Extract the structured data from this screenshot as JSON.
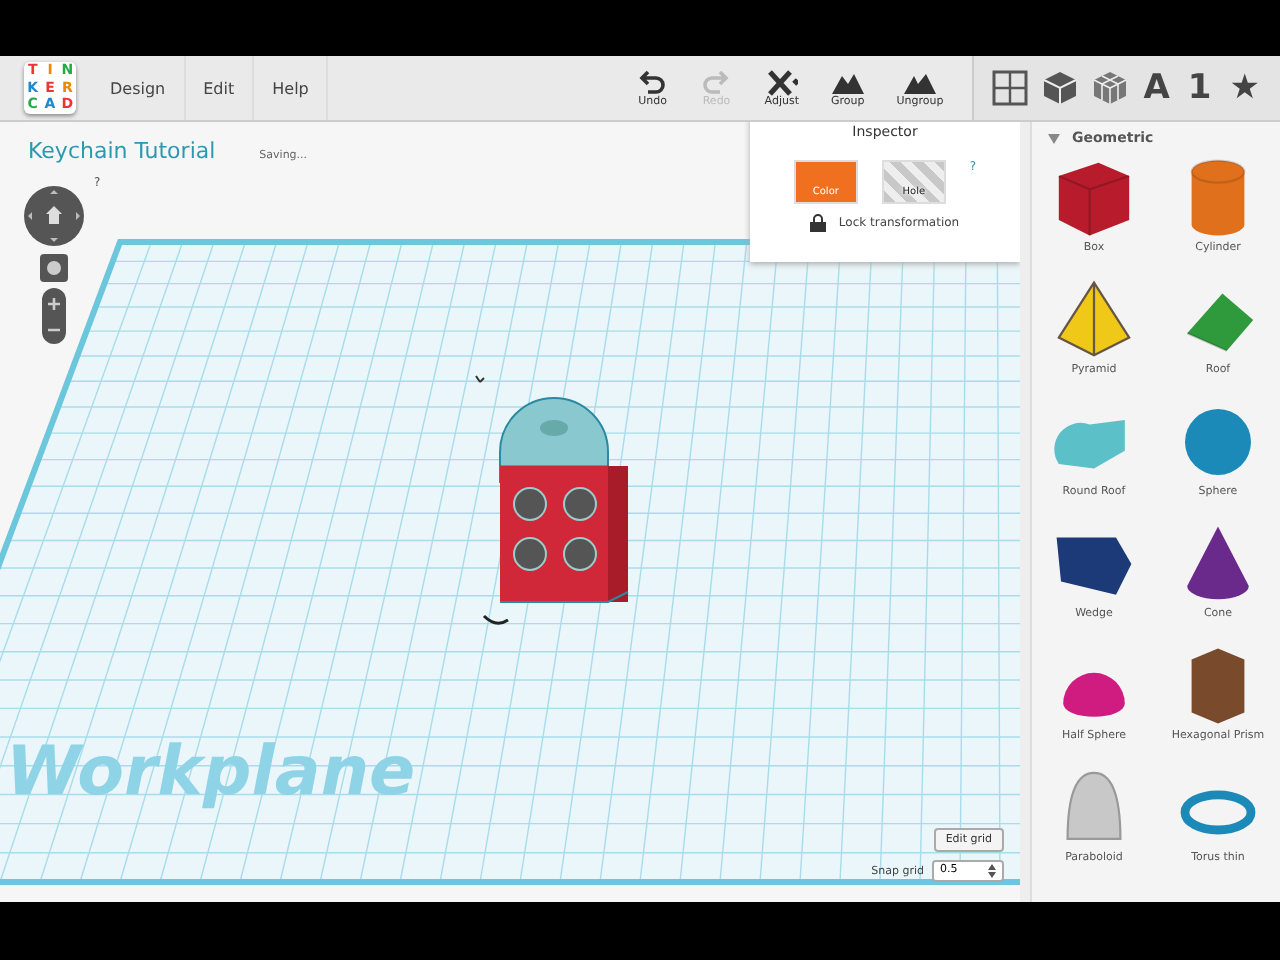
{
  "menu": [
    {
      "label": "Design"
    },
    {
      "label": "Edit"
    },
    {
      "label": "Help"
    }
  ],
  "logo": [
    "T",
    "I",
    "N",
    "K",
    "E",
    "R",
    "C",
    "A",
    "D"
  ],
  "toolbar": [
    {
      "kind": "undo",
      "label": "Undo",
      "disabled": false
    },
    {
      "kind": "redo",
      "label": "Redo",
      "disabled": true
    },
    {
      "kind": "adjust",
      "label": "Adjust",
      "disabled": false
    },
    {
      "kind": "group",
      "label": "Group",
      "disabled": false
    },
    {
      "kind": "ungroup",
      "label": "Ungroup",
      "disabled": false
    }
  ],
  "view_buttons": [
    {
      "kind": "grid"
    },
    {
      "kind": "cube"
    },
    {
      "kind": "wire"
    },
    {
      "kind": "text",
      "label": "A"
    },
    {
      "kind": "text",
      "label": "1"
    },
    {
      "kind": "text",
      "label": "★"
    }
  ],
  "design_title": "Keychain Tutorial",
  "status": "Saving...",
  "inspector": {
    "title": "Inspector",
    "swatches": [
      {
        "kind": "solid",
        "label": "Color",
        "color": "#f07020"
      },
      {
        "kind": "hole",
        "label": "Hole",
        "color": "#c8c8c8"
      }
    ],
    "help": "?",
    "lock": "Lock transformation"
  },
  "view_help": "?",
  "workplane_label": "Workplane",
  "edit_grid": "Edit grid",
  "snap_grid": {
    "label": "Snap grid",
    "value": "0.5"
  },
  "panel": {
    "title": "Geometric",
    "expanded": true,
    "shapes": [
      {
        "kind": "box",
        "label": "Box",
        "color": "#b81c2c"
      },
      {
        "kind": "cylinder",
        "label": "Cylinder",
        "color": "#e0701c"
      },
      {
        "kind": "pyramid",
        "label": "Pyramid",
        "color": "#f0c818"
      },
      {
        "kind": "roof",
        "label": "Roof",
        "color": "#2e9a3c"
      },
      {
        "kind": "roundroof",
        "label": "Round Roof",
        "color": "#5cc0c8"
      },
      {
        "kind": "sphere",
        "label": "Sphere",
        "color": "#1c8ab8"
      },
      {
        "kind": "wedge",
        "label": "Wedge",
        "color": "#1c3a78"
      },
      {
        "kind": "cone",
        "label": "Cone",
        "color": "#6a2a8c"
      },
      {
        "kind": "halfsphere",
        "label": "Half Sphere",
        "color": "#d01c80"
      },
      {
        "kind": "hexprism",
        "label": "Hexagonal Prism",
        "color": "#7a4a2c"
      },
      {
        "kind": "paraboloid",
        "label": "Paraboloid",
        "color": "#c8c8c8"
      },
      {
        "kind": "torus",
        "label": "Torus thin",
        "color": "#1c8ab8"
      }
    ]
  }
}
